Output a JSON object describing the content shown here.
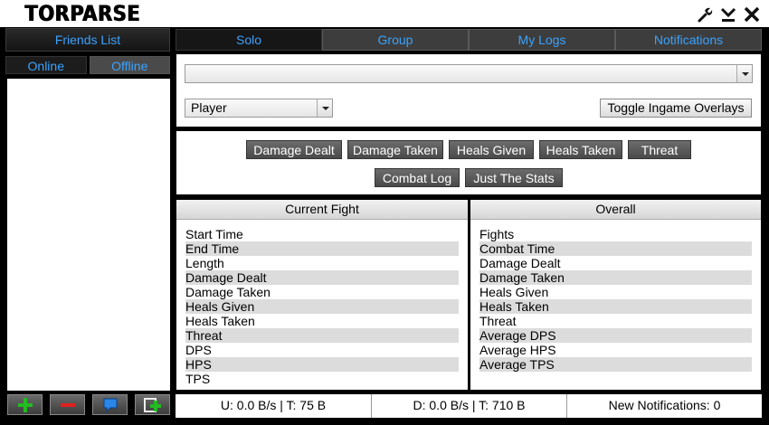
{
  "app": {
    "logo": "TORPARSE"
  },
  "window": {
    "settings_icon": "wrench-icon",
    "minimize_icon": "minimize-icon",
    "close_icon": "close-icon"
  },
  "friends": {
    "header": "Friends List",
    "tabs": [
      {
        "label": "Online"
      },
      {
        "label": "Offline"
      }
    ]
  },
  "friends_actions": [
    {
      "name": "add-friend-button",
      "icon": "plus-icon",
      "color": "#22aa22"
    },
    {
      "name": "remove-friend-button",
      "icon": "minus-icon",
      "color": "#dd2222"
    },
    {
      "name": "chat-button",
      "icon": "chat-bubble-icon",
      "color": "#2277dd"
    },
    {
      "name": "add-group-button",
      "icon": "group-add-icon",
      "color": "#22aa22"
    }
  ],
  "main_tabs": [
    {
      "label": "Solo"
    },
    {
      "label": "Group"
    },
    {
      "label": "My Logs"
    },
    {
      "label": "Notifications"
    }
  ],
  "controls": {
    "log_select_value": "",
    "player_select_value": "Player",
    "toggle_overlays_label": "Toggle Ingame Overlays"
  },
  "view_buttons": [
    {
      "label": "Damage Dealt"
    },
    {
      "label": "Damage Taken"
    },
    {
      "label": "Heals Given"
    },
    {
      "label": "Heals Taken"
    },
    {
      "label": "Threat"
    },
    {
      "label": "Combat Log"
    },
    {
      "label": "Just The Stats"
    }
  ],
  "current_fight": {
    "header": "Current Fight",
    "rows": [
      "Start Time",
      "End Time",
      "Length",
      "Damage Dealt",
      "Damage Taken",
      "Heals Given",
      "Heals Taken",
      "Threat",
      "DPS",
      "HPS",
      "TPS"
    ]
  },
  "overall": {
    "header": "Overall",
    "rows": [
      "Fights",
      "Combat Time",
      "Damage Dealt",
      "Damage Taken",
      "Heals Given",
      "Heals Taken",
      "Threat",
      "Average DPS",
      "Average HPS",
      "Average TPS"
    ]
  },
  "status": {
    "upload": "U: 0.0 B/s | T: 75 B",
    "download": "D: 0.0 B/s | T: 710 B",
    "notifications": "New Notifications: 0"
  },
  "colors": {
    "accent": "#3aa3ff",
    "background": "#000000"
  }
}
